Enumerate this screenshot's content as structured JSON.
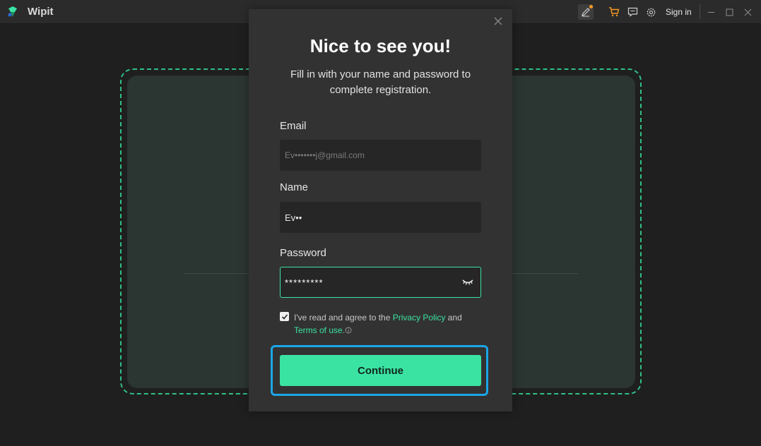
{
  "app": {
    "name": "Wipit"
  },
  "titlebar": {
    "signin_label": "Sign in"
  },
  "modal": {
    "title": "Nice to see you!",
    "subtitle": "Fill in with your name and password to complete registration.",
    "email_label": "Email",
    "email_value": "Ev•••••••j@gmail.com",
    "name_label": "Name",
    "name_value": "Ev••",
    "password_label": "Password",
    "password_value": "*********",
    "agree_text_1": "I've read and agree to the ",
    "privacy_link": "Privacy Policy",
    "agree_text_2": " and",
    "terms_link": "Terms of use.",
    "continue_label": "Continue"
  },
  "colors": {
    "accent": "#3be3a3",
    "focus_ring": "#1aa6e8",
    "dropzone_border": "#2fbf86",
    "notification_dot": "#f59a23"
  }
}
